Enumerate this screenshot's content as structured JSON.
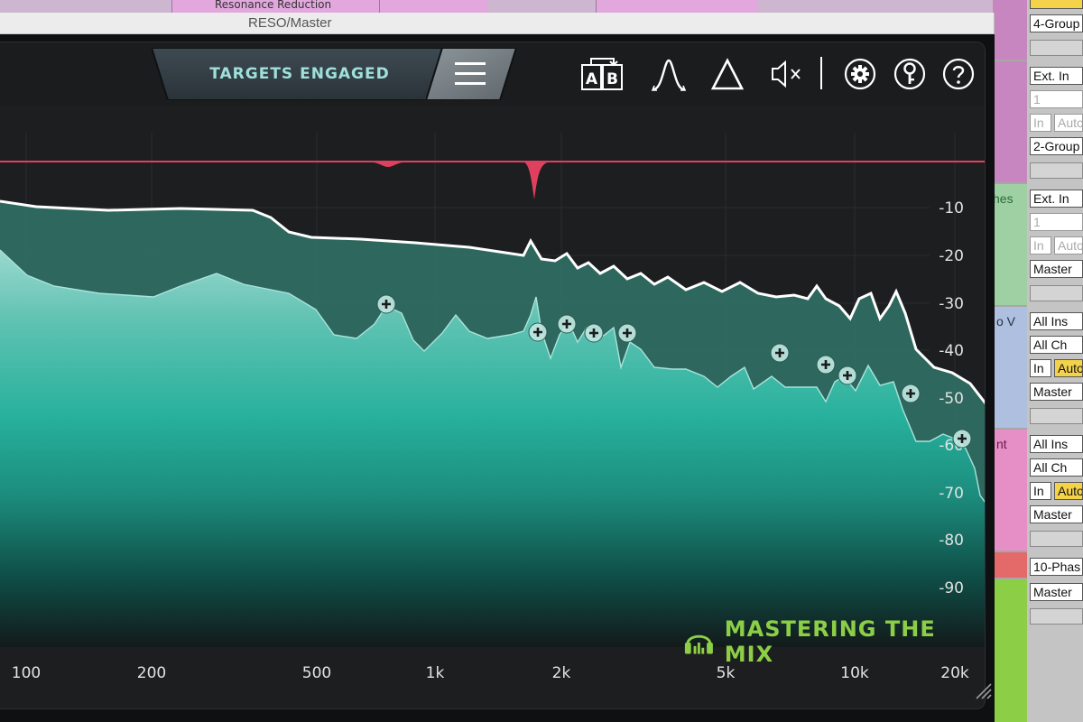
{
  "window": {
    "title": "RESO/Master"
  },
  "daw_clip_label": "Resonance Reduction",
  "toolbar": {
    "status_label": "TARGETS ENGAGED",
    "ab_label_a": "A",
    "ab_label_b": "B"
  },
  "icons": [
    "menu-icon",
    "ab-compare-icon",
    "bell-curve-icon",
    "triangle-icon",
    "speaker-mute-icon",
    "gear-icon",
    "key-icon",
    "help-icon"
  ],
  "graph": {
    "db_labels": [
      "-10",
      "-20",
      "-30",
      "-40",
      "-50",
      "-60",
      "-70",
      "-80",
      "-90"
    ],
    "freq_labels": [
      "100",
      "200",
      "500",
      "1k",
      "2k",
      "5k",
      "10k",
      "20k"
    ],
    "colors": {
      "target_line": "#e0405f",
      "spectrum_top": "#8ad3c9",
      "spectrum_mid": "#25b09c",
      "envelope": "#ffffff",
      "accent": "#8ccf47"
    }
  },
  "brand": {
    "name": "MASTERING THE MIX"
  },
  "mixer": {
    "tracks": [
      {
        "name": "",
        "color": "#c786bf"
      },
      {
        "name": "",
        "color": "#c786bf"
      },
      {
        "name": "hes",
        "color": "#9fd0a3"
      },
      {
        "name": "o V",
        "color": "#aebfe0"
      },
      {
        "name": "nt",
        "color": "#e58fc6"
      }
    ],
    "io": {
      "group4": "4-Group",
      "ext_in_1": "Ext. In",
      "ch1": "1",
      "in": "In",
      "auto": "Auto",
      "group2": "2-Group",
      "ext_in_2": "Ext. In",
      "ch2": "1",
      "master": "Master",
      "all_ins": "All Ins",
      "all_ch": "All Ch",
      "phase10": "10-Phas"
    }
  }
}
